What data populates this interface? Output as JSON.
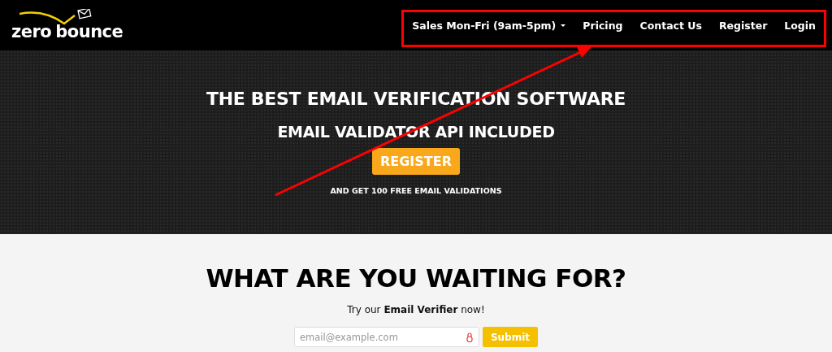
{
  "header": {
    "logo": {
      "word_1": "zero",
      "word_2": "bounce"
    },
    "nav": [
      {
        "label": "Sales Mon-Fri (9am-5pm)",
        "dropdown": true
      },
      {
        "label": "Pricing",
        "dropdown": false
      },
      {
        "label": "Contact Us",
        "dropdown": false
      },
      {
        "label": "Register",
        "dropdown": false
      },
      {
        "label": "Login",
        "dropdown": false
      }
    ]
  },
  "hero": {
    "title": "THE BEST EMAIL VERIFICATION SOFTWARE",
    "subtitle": "EMAIL VALIDATOR API INCLUDED",
    "button": "REGISTER",
    "note": "AND GET 100 FREE EMAIL VALIDATIONS"
  },
  "cta": {
    "title": "WHAT ARE YOU WAITING FOR?",
    "text": "Try our **Email Verifier** now!",
    "email_field": {
      "placeholder": "email@example.com"
    },
    "button": "Submit"
  }
}
